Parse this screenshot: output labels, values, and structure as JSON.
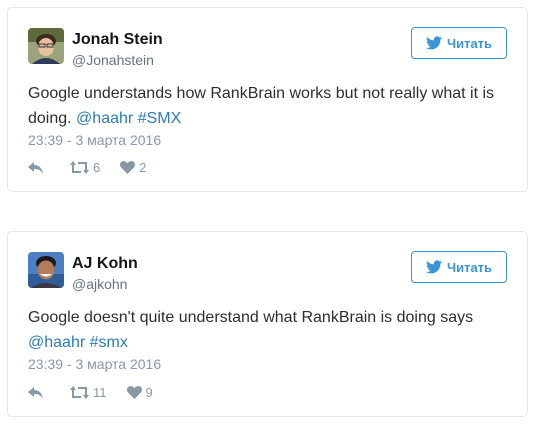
{
  "tweets": [
    {
      "name": "Jonah Stein",
      "handle": "@Jonahstein",
      "text_plain": "Google understands how RankBrain works but not really what it is doing. ",
      "mention": "@haahr",
      "hashtag": "#SMX",
      "timestamp": "23:39 - 3 марта 2016",
      "follow_label": "Читать",
      "retweets": "6",
      "likes": "2"
    },
    {
      "name": "AJ Kohn",
      "handle": "@ajkohn",
      "text_plain": "Google doesn't quite understand what RankBrain is doing says ",
      "mention": "@haahr",
      "hashtag": "#smx",
      "timestamp": "23:39 - 3 марта 2016",
      "follow_label": "Читать",
      "retweets": "11",
      "likes": "9"
    }
  ],
  "colors": {
    "link": "#2b7bb9",
    "button": "#3b94d9",
    "muted": "#8899a6",
    "border": "#e1e8ed"
  },
  "icons": [
    "twitter-bird-icon",
    "reply-icon",
    "retweet-icon",
    "heart-icon"
  ]
}
